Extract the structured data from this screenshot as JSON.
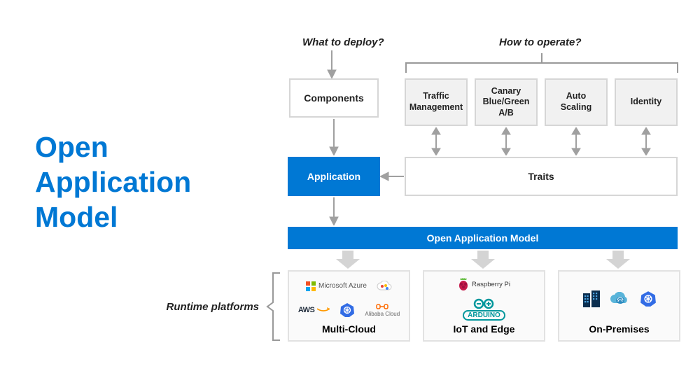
{
  "title_lines": [
    "Open",
    "Application",
    "Model"
  ],
  "questions": {
    "deploy": "What to deploy?",
    "operate": "How to operate?"
  },
  "nodes": {
    "components": "Components",
    "application": "Application",
    "traits": "Traits",
    "oam_bar": "Open Application Model"
  },
  "traits": {
    "traffic": "Traffic Management",
    "canary": "Canary Blue/Green A/B",
    "autoscale": "Auto Scaling",
    "identity": "Identity"
  },
  "runtime_label": "Runtime platforms",
  "platforms": {
    "multicloud": {
      "label": "Multi-Cloud",
      "vendors": {
        "azure": "Microsoft Azure",
        "gcp": "Google Cloud",
        "aws": "AWS",
        "kubernetes": "Kubernetes",
        "alibaba": "Alibaba Cloud"
      }
    },
    "iot": {
      "label": "IoT and Edge",
      "vendors": {
        "raspberrypi": "Raspberry Pi",
        "arduino": "ARDUINO"
      }
    },
    "onprem": {
      "label": "On-Premises",
      "vendors": {
        "datacenter": "Data center",
        "server": "Server",
        "kubernetes": "Kubernetes"
      }
    }
  }
}
